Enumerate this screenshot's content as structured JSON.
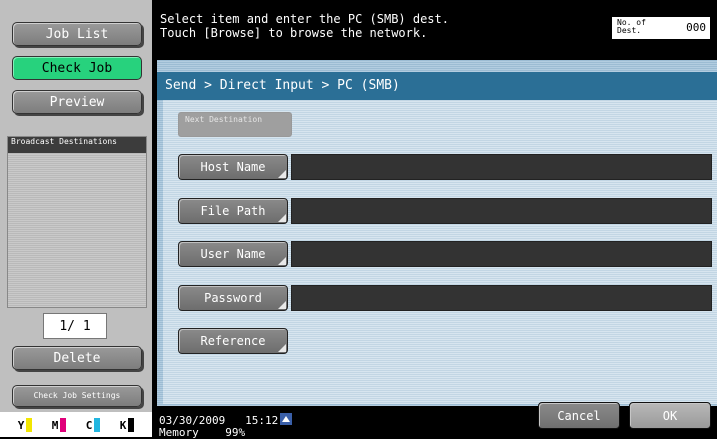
{
  "sidebar": {
    "job_list": "Job List",
    "check_job": "Check Job",
    "preview": "Preview",
    "broadcast_header": "Broadcast Destinations",
    "page_indicator": "1/ 1",
    "delete": "Delete",
    "check_job_settings": "Check Job Settings",
    "toner": [
      {
        "label": "Y",
        "color": "#f2e600"
      },
      {
        "label": "M",
        "color": "#e0007a"
      },
      {
        "label": "C",
        "color": "#22b6e0"
      },
      {
        "label": "K",
        "color": "#000000"
      }
    ]
  },
  "header": {
    "message_line1": "Select item and enter the PC (SMB) dest.",
    "message_line2": "Touch [Browse] to browse the network.",
    "dest_label": "No. of Dest.",
    "dest_count": "000"
  },
  "panel": {
    "breadcrumb": "Send > Direct Input > PC (SMB)",
    "next_destination": "Next Destination",
    "fields": [
      {
        "label": "Host Name",
        "value": ""
      },
      {
        "label": "File Path",
        "value": ""
      },
      {
        "label": "User Name",
        "value": ""
      },
      {
        "label": "Password",
        "value": ""
      }
    ],
    "reference": "Reference"
  },
  "status": {
    "date": "03/30/2009",
    "time": "15:12",
    "memory_label": "Memory",
    "memory_value": "99%"
  },
  "actions": {
    "cancel": "Cancel",
    "ok": "OK"
  },
  "colors": {
    "check_job_green": "#27d27d",
    "header_blue": "#2b6f96"
  }
}
